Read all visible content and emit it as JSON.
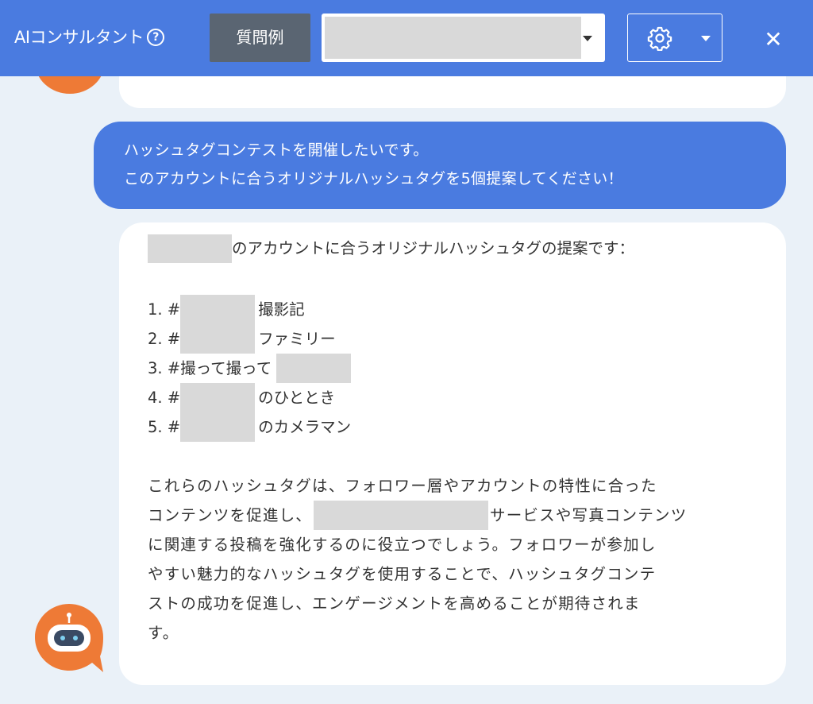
{
  "header": {
    "title": "AIコンサルタント",
    "help_glyph": "?",
    "examples_label": "質問例",
    "select_value": "",
    "close_glyph": "✕",
    "bg_color": "#4a7be0"
  },
  "icons": {
    "help": "help-circle-icon",
    "gear": "gear-icon",
    "caret": "chevron-down-icon",
    "close": "close-icon",
    "avatar": "robot-avatar-icon"
  },
  "chat": {
    "user_message": {
      "lines": [
        "ハッシュタグコンテストを開催したいです。",
        "このアカウントに合うオリジナルハッシュタグを5個提案してください！"
      ]
    },
    "bot_message": {
      "intro": "のアカウントに合うオリジナルハッシュタグの提案です：",
      "items": [
        {
          "prefix": "1. #",
          "suffix": "撮影記"
        },
        {
          "prefix": "2. #",
          "suffix": "ファミリー"
        },
        {
          "prefix": "3. #撮って撮って",
          "suffix": ""
        },
        {
          "prefix": "4. #",
          "suffix": "のひととき"
        },
        {
          "prefix": "5. #",
          "suffix": "のカメラマン"
        }
      ],
      "paragraph": {
        "line1": "これらのハッシュタグは、フォロワー層やアカウントの特性に合った",
        "line2_a": "コンテンツを促進し、",
        "line2_b": "サービスや写真コンテンツ",
        "line3": "に関連する投稿を強化するのに役立つでしょう。フォロワーが参加し",
        "line4": "やすい魅力的なハッシュタグを使用することで、ハッシュタグコンテ",
        "line5": "ストの成功を促進し、エンゲージメントを高めることが期待されま",
        "line6": "す。"
      }
    }
  },
  "colors": {
    "user_bubble": "#4a7be0",
    "bot_bubble": "#ffffff",
    "background": "#eaf1f8",
    "avatar": "#ee7a36",
    "redaction": "#d9d9d9"
  }
}
